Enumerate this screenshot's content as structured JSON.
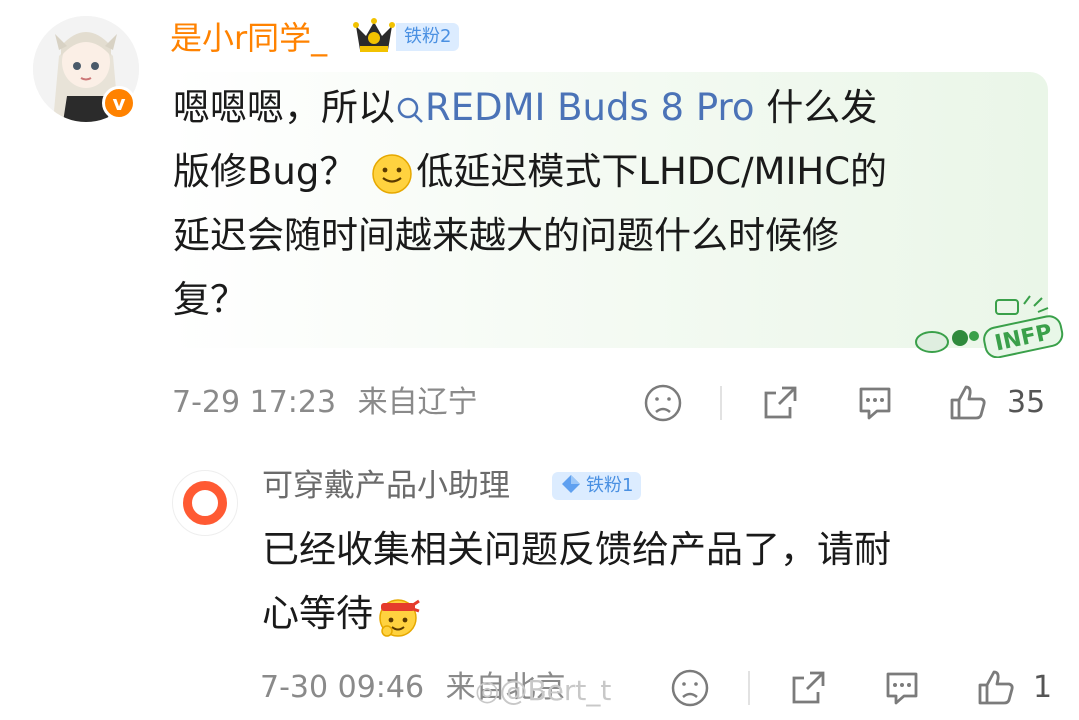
{
  "comment": {
    "username": "是小r同学_",
    "fan_badge": "铁粉2",
    "text_line1_pre": "嗯嗯嗯，所以",
    "topic_link": "REDMI Buds 8 Pro",
    "text_line1_post": " 什么发",
    "text_line2_pre": "版修Bug？",
    "text_line2_post": "低延迟模式下LHDC/MIHC的",
    "text_line3": "延迟会随时间越来越大的问题什么时候修",
    "text_line4": "复？",
    "sticker_text": "INFP",
    "time": "7-29 17:23",
    "location": "来自辽宁",
    "like_count": "35",
    "icons": {
      "avatar": "anime-girl-avatar",
      "verified": "orange-v-badge",
      "crown": "crown-icon",
      "dislike": "frown-face-icon",
      "share": "share-icon",
      "comment": "comment-icon",
      "like": "thumbs-up-icon"
    }
  },
  "reply": {
    "username": "可穿戴产品小助理",
    "fan_badge": "铁粉1",
    "text_line1": "已经收集相关问题反馈给产品了，请耐",
    "text_line2": "心等待",
    "time": "7-30 09:46",
    "location": "来自北京",
    "like_count": "1"
  },
  "watermark": "@Bert_t",
  "colors": {
    "username": "#ff8200",
    "topic": "#4b73b7",
    "badge_bg": "#dcecff",
    "badge_text": "#4a90e2",
    "brand_ring": "#ff5a33"
  }
}
